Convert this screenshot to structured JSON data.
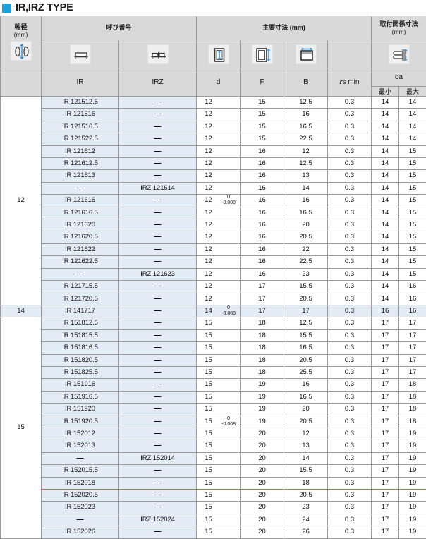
{
  "title": {
    "text": "IR,IRZ  TYPE",
    "marker_color": "#1ba2dd"
  },
  "header": {
    "shaft_diameter": "軸径",
    "shaft_diameter_unit": "(mm)",
    "designation": "呼び番号",
    "main_dimensions": "主要寸法 (mm)",
    "mounting_dimensions": "取付関係寸法",
    "mounting_dimensions_unit": "(mm)",
    "col_ir": "IR",
    "col_irz": "IRZ",
    "col_d": "d",
    "col_f": "F",
    "col_b": "B",
    "col_rsmin_r": "r",
    "col_rsmin_rest": "s min",
    "col_da": "da",
    "col_da_min": "最小",
    "col_da_max": "最大",
    "icons": {
      "shaft": "shaft-diameter-icon",
      "ir": "ir-ring-icon",
      "irz": "irz-ring-icon",
      "d": "bore-diameter-icon",
      "f": "outer-diameter-icon",
      "b": "width-icon",
      "mounting": "mounting-shoulder-icon"
    }
  },
  "tolerance": {
    "upper": "0",
    "lower": "-0.008"
  },
  "sections": [
    {
      "shaft": "12",
      "tolerance_row": 8,
      "rows": [
        {
          "ir": "IR 121512.5",
          "irz": "—",
          "d": "12",
          "f": "15",
          "b": "12.5",
          "rs": "0.3",
          "damin": "14",
          "damax": "14"
        },
        {
          "ir": "IR 121516",
          "irz": "—",
          "d": "12",
          "f": "15",
          "b": "16",
          "rs": "0.3",
          "damin": "14",
          "damax": "14"
        },
        {
          "ir": "IR 121516.5",
          "irz": "—",
          "d": "12",
          "f": "15",
          "b": "16.5",
          "rs": "0.3",
          "damin": "14",
          "damax": "14"
        },
        {
          "ir": "IR 121522.5",
          "irz": "—",
          "d": "12",
          "f": "15",
          "b": "22.5",
          "rs": "0.3",
          "damin": "14",
          "damax": "14"
        },
        {
          "ir": "IR 121612",
          "irz": "—",
          "d": "12",
          "f": "16",
          "b": "12",
          "rs": "0.3",
          "damin": "14",
          "damax": "15"
        },
        {
          "ir": "IR 121612.5",
          "irz": "—",
          "d": "12",
          "f": "16",
          "b": "12.5",
          "rs": "0.3",
          "damin": "14",
          "damax": "15"
        },
        {
          "ir": "IR 121613",
          "irz": "—",
          "d": "12",
          "f": "16",
          "b": "13",
          "rs": "0.3",
          "damin": "14",
          "damax": "15"
        },
        {
          "ir": "—",
          "irz": "IRZ 121614",
          "d": "12",
          "f": "16",
          "b": "14",
          "rs": "0.3",
          "damin": "14",
          "damax": "15"
        },
        {
          "ir": "IR 121616",
          "irz": "—",
          "d": "12",
          "f": "16",
          "b": "16",
          "rs": "0.3",
          "damin": "14",
          "damax": "15"
        },
        {
          "ir": "IR 121616.5",
          "irz": "—",
          "d": "12",
          "f": "16",
          "b": "16.5",
          "rs": "0.3",
          "damin": "14",
          "damax": "15"
        },
        {
          "ir": "IR 121620",
          "irz": "—",
          "d": "12",
          "f": "16",
          "b": "20",
          "rs": "0.3",
          "damin": "14",
          "damax": "15"
        },
        {
          "ir": "IR 121620.5",
          "irz": "—",
          "d": "12",
          "f": "16",
          "b": "20.5",
          "rs": "0.3",
          "damin": "14",
          "damax": "15"
        },
        {
          "ir": "IR 121622",
          "irz": "—",
          "d": "12",
          "f": "16",
          "b": "22",
          "rs": "0.3",
          "damin": "14",
          "damax": "15"
        },
        {
          "ir": "IR 121622.5",
          "irz": "—",
          "d": "12",
          "f": "16",
          "b": "22.5",
          "rs": "0.3",
          "damin": "14",
          "damax": "15"
        },
        {
          "ir": "—",
          "irz": "IRZ 121623",
          "d": "12",
          "f": "16",
          "b": "23",
          "rs": "0.3",
          "damin": "14",
          "damax": "15"
        },
        {
          "ir": "IR 121715.5",
          "irz": "—",
          "d": "12",
          "f": "17",
          "b": "15.5",
          "rs": "0.3",
          "damin": "14",
          "damax": "16"
        },
        {
          "ir": "IR 121720.5",
          "irz": "—",
          "d": "12",
          "f": "17",
          "b": "20.5",
          "rs": "0.3",
          "damin": "14",
          "damax": "16"
        }
      ]
    },
    {
      "shaft": "14",
      "highlight": true,
      "tolerance_row": 0,
      "rows": [
        {
          "ir": "IR 141717",
          "irz": "—",
          "d": "14",
          "f": "17",
          "b": "17",
          "rs": "0.3",
          "damin": "16",
          "damax": "16"
        }
      ]
    },
    {
      "shaft": "15",
      "tolerance_row": 8,
      "redline_after": 12,
      "rows": [
        {
          "ir": "IR 151812.5",
          "irz": "—",
          "d": "15",
          "f": "18",
          "b": "12.5",
          "rs": "0.3",
          "damin": "17",
          "damax": "17"
        },
        {
          "ir": "IR 151815.5",
          "irz": "—",
          "d": "15",
          "f": "18",
          "b": "15.5",
          "rs": "0.3",
          "damin": "17",
          "damax": "17"
        },
        {
          "ir": "IR 151816.5",
          "irz": "—",
          "d": "15",
          "f": "18",
          "b": "16.5",
          "rs": "0.3",
          "damin": "17",
          "damax": "17"
        },
        {
          "ir": "IR 151820.5",
          "irz": "—",
          "d": "15",
          "f": "18",
          "b": "20.5",
          "rs": "0.3",
          "damin": "17",
          "damax": "17"
        },
        {
          "ir": "IR 151825.5",
          "irz": "—",
          "d": "15",
          "f": "18",
          "b": "25.5",
          "rs": "0.3",
          "damin": "17",
          "damax": "17"
        },
        {
          "ir": "IR 151916",
          "irz": "—",
          "d": "15",
          "f": "19",
          "b": "16",
          "rs": "0.3",
          "damin": "17",
          "damax": "18"
        },
        {
          "ir": "IR 151916.5",
          "irz": "—",
          "d": "15",
          "f": "19",
          "b": "16.5",
          "rs": "0.3",
          "damin": "17",
          "damax": "18"
        },
        {
          "ir": "IR 151920",
          "irz": "—",
          "d": "15",
          "f": "19",
          "b": "20",
          "rs": "0.3",
          "damin": "17",
          "damax": "18"
        },
        {
          "ir": "IR 151920.5",
          "irz": "—",
          "d": "15",
          "f": "19",
          "b": "20.5",
          "rs": "0.3",
          "damin": "17",
          "damax": "18"
        },
        {
          "ir": "IR 152012",
          "irz": "—",
          "d": "15",
          "f": "20",
          "b": "12",
          "rs": "0.3",
          "damin": "17",
          "damax": "19"
        },
        {
          "ir": "IR 152013",
          "irz": "—",
          "d": "15",
          "f": "20",
          "b": "13",
          "rs": "0.3",
          "damin": "17",
          "damax": "19"
        },
        {
          "ir": "—",
          "irz": "IRZ 152014",
          "d": "15",
          "f": "20",
          "b": "14",
          "rs": "0.3",
          "damin": "17",
          "damax": "19"
        },
        {
          "ir": "IR 152015.5",
          "irz": "—",
          "d": "15",
          "f": "20",
          "b": "15.5",
          "rs": "0.3",
          "damin": "17",
          "damax": "19"
        },
        {
          "ir": "IR 152018",
          "irz": "—",
          "d": "15",
          "f": "20",
          "b": "18",
          "rs": "0.3",
          "damin": "17",
          "damax": "19"
        },
        {
          "ir": "IR 152020.5",
          "irz": "—",
          "d": "15",
          "f": "20",
          "b": "20.5",
          "rs": "0.3",
          "damin": "17",
          "damax": "19"
        },
        {
          "ir": "IR 152023",
          "irz": "—",
          "d": "15",
          "f": "20",
          "b": "23",
          "rs": "0.3",
          "damin": "17",
          "damax": "19"
        },
        {
          "ir": "—",
          "irz": "IRZ 152024",
          "d": "15",
          "f": "20",
          "b": "24",
          "rs": "0.3",
          "damin": "17",
          "damax": "19"
        },
        {
          "ir": "IR 152026",
          "irz": "—",
          "d": "15",
          "f": "20",
          "b": "26",
          "rs": "0.3",
          "damin": "17",
          "damax": "19"
        }
      ]
    }
  ]
}
